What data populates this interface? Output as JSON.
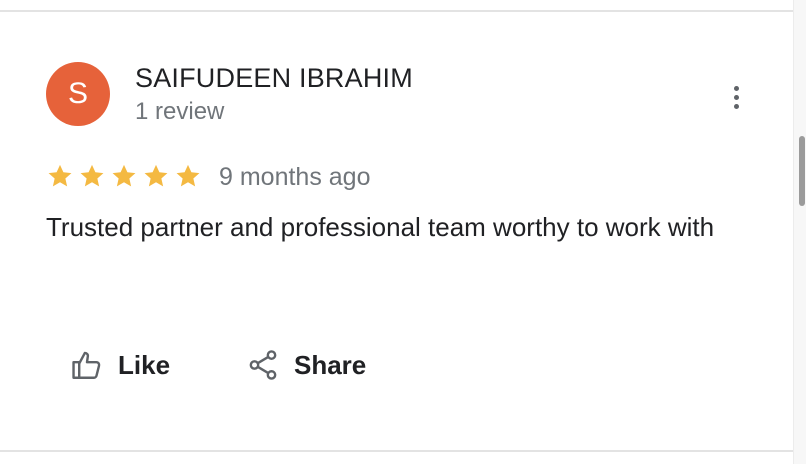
{
  "review": {
    "avatar_letter": "S",
    "avatar_color": "#e6623a",
    "reviewer_name": "SAIFUDEEN IBRAHIM",
    "review_count": "1 review",
    "rating": 5,
    "max_rating": 5,
    "star_color": "#f4b942",
    "timestamp": "9 months ago",
    "text": "Trusted partner and professional team worthy to work with"
  },
  "actions": {
    "like_label": "Like",
    "share_label": "Share"
  },
  "icons": {
    "more": "more-vertical-icon",
    "like": "thumbs-up-icon",
    "share": "share-icon",
    "star": "star-icon"
  }
}
